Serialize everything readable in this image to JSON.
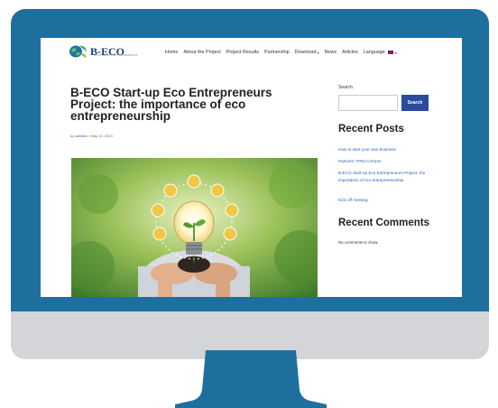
{
  "header": {
    "logo_text": "B-ECO",
    "logo_subtitle": "START-UP ECO ENTREPRENEURS",
    "nav": [
      {
        "label": "Home"
      },
      {
        "label": "About the Project"
      },
      {
        "label": "Project Results"
      },
      {
        "label": "Partnership"
      },
      {
        "label": "Download",
        "has_dropdown": true
      },
      {
        "label": "News"
      },
      {
        "label": "Articles"
      },
      {
        "label": "Language",
        "has_dropdown": true,
        "flag": "uk-flag-icon"
      }
    ]
  },
  "article": {
    "title": "B-ECO Start-up Eco Entrepreneurs Project: the importance of eco entrepreneurship",
    "meta_prefix": "by",
    "author": "adminic",
    "separator": "/",
    "date": "May 10, 2023",
    "hero_image": "hands-holding-seedling-lightbulb-image"
  },
  "sidebar": {
    "search_label": "Search",
    "search_placeholder": "",
    "search_button": "Search",
    "recent_posts_heading": "Recent Posts",
    "recent_posts": [
      {
        "label": "How to start your own business"
      },
      {
        "label": "Partners' TPM in Rome"
      },
      {
        "label": "B-ECO Start-up Eco Entrepreneurs Project: the importance of eco entrepreneurship"
      },
      {
        "label": "Kick off meeting"
      }
    ],
    "recent_comments_heading": "Recent Comments",
    "no_comments": "No comments to show."
  },
  "colors": {
    "monitor_bezel": "#1f6f9e",
    "monitor_chin": "#d3d5d9",
    "stand": "#1f6f9e",
    "link": "#2f63b8",
    "button": "#2a4c9b"
  }
}
